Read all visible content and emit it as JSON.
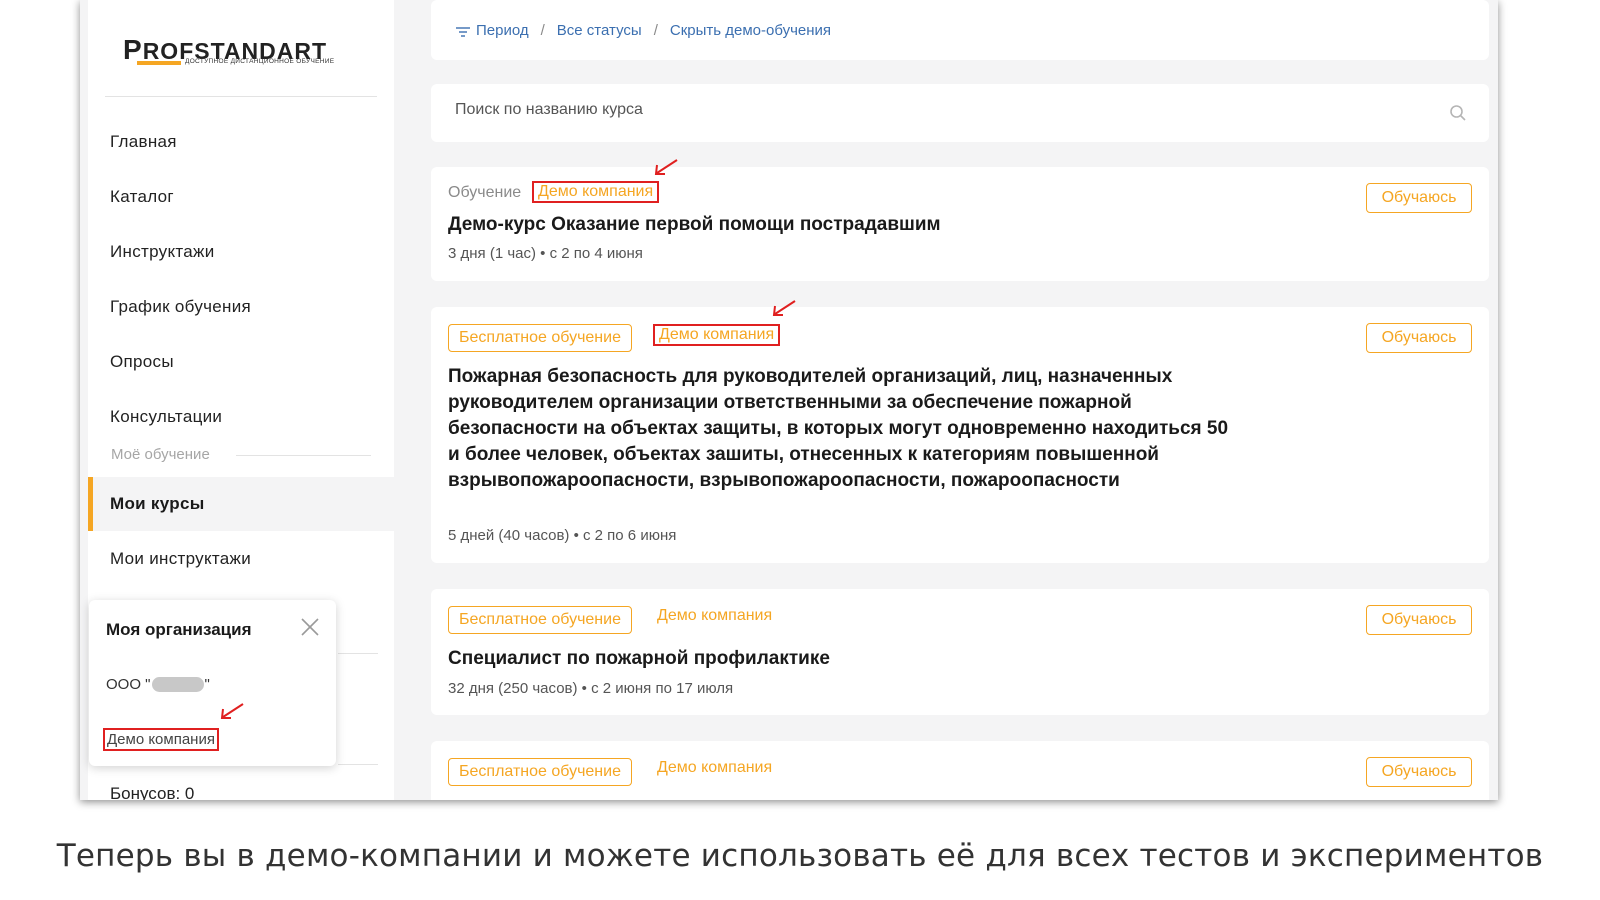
{
  "logo": {
    "brand_first": "P",
    "brand_rest": "ROFSTANDART",
    "tagline": "ДОСТУПНОЕ ДИСТАНЦИОННОЕ ОБУЧЕНИЕ"
  },
  "sidebar": {
    "items": [
      {
        "label": "Главная"
      },
      {
        "label": "Каталог"
      },
      {
        "label": "Инструктажи"
      },
      {
        "label": "График обучения"
      },
      {
        "label": "Опросы"
      },
      {
        "label": "Консультации"
      }
    ],
    "section_label": "Моё обучение",
    "active_item": "Мои курсы",
    "item_instructions": "Мои инструктажи",
    "bonus": "Бонусов: 0"
  },
  "org_popup": {
    "title": "Моя организация",
    "org_prefix": "ООО \"",
    "org_suffix": "\"",
    "demo_label": "Демо компания"
  },
  "filters": {
    "period": "Период",
    "statuses": "Все статусы",
    "hide_demo": "Скрыть демо-обучения",
    "separator": "/"
  },
  "search": {
    "placeholder": "Поиск по названию курса"
  },
  "courses": [
    {
      "tag": "Обучение",
      "company": "Демо компания",
      "title": "Демо-курс Оказание первой помощи пострадавшим",
      "meta": "3 дня (1 час) • с 2 по 4 июня",
      "status": "Обучаюсь"
    },
    {
      "tag": "Бесплатное обучение",
      "company": "Демо компания",
      "title": "Пожарная безопасность для руководителей организаций, лиц, назначенных руководителем организации ответственными за обеспечение пожарной безопасности на объектах защиты, в которых могут одновременно находиться 50 и более человек, объектах зашиты, отнесенных к категориям повышенной взрывопожароопасности, взрывопожароопасности, пожароопасности",
      "meta": "5 дней (40 часов) • с 2 по 6 июня",
      "status": "Обучаюсь"
    },
    {
      "tag": "Бесплатное обучение",
      "company": "Демо компания",
      "title": "Специалист по пожарной профилактике",
      "meta": "32 дня (250 часов) • с 2 июня по 17 июля",
      "status": "Обучаюсь"
    },
    {
      "tag": "Бесплатное обучение",
      "company": "Демо компания",
      "status": "Обучаюсь"
    }
  ],
  "caption": "Теперь вы в демо-компании и можете использовать её для всех тестов и экспериментов",
  "colors": {
    "accent": "#f5a623",
    "link": "#3b6fb0",
    "highlight": "#e02020"
  }
}
